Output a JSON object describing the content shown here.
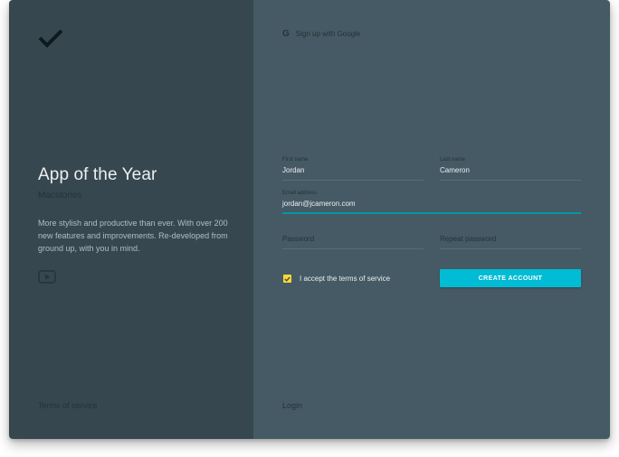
{
  "brand": {
    "logo_icon": "checkmark-icon"
  },
  "promo": {
    "title": "App of the Year",
    "subtitle": "Macstories",
    "description": "More stylish and productive than ever. With over 200 new features and improvements. Re-developed from ground up, with you in mind.",
    "video_icon": "play-video-icon"
  },
  "footer_left": {
    "terms_link": "Terms of service"
  },
  "signup": {
    "google_icon": "google-icon",
    "google_label": "Sign up with Google",
    "first_name": {
      "label": "First name",
      "value": "Jordan"
    },
    "last_name": {
      "label": "Last name",
      "value": "Cameron"
    },
    "email": {
      "label": "Email address",
      "value": "jordan@jcameron.com"
    },
    "password": {
      "placeholder": "Password",
      "value": ""
    },
    "repeat_password": {
      "placeholder": "Repeat password",
      "value": ""
    },
    "terms_checkbox": {
      "label": "I accept the terms of service",
      "checked": true
    },
    "create_button": "CREATE ACCOUNT",
    "login_link": "Login"
  },
  "colors": {
    "left_panel": "#37474f",
    "right_panel": "#455a64",
    "accent": "#00bcd4",
    "checkbox": "#fdd835"
  }
}
